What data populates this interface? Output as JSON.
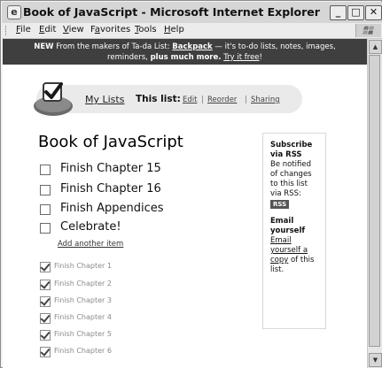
{
  "window": {
    "title": "Book of JavaScript - Microsoft Internet Explorer",
    "app_icon": "e",
    "controls": {
      "minimize": "_",
      "maximize": "□",
      "close": "✕"
    }
  },
  "menu": [
    {
      "label": "File",
      "key": "F"
    },
    {
      "label": "Edit",
      "key": "E"
    },
    {
      "label": "View",
      "key": "V"
    },
    {
      "label": "Favorites",
      "key": "a"
    },
    {
      "label": "Tools",
      "key": "T"
    },
    {
      "label": "Help",
      "key": "H"
    }
  ],
  "banner": {
    "new": "NEW",
    "text1": "From the makers of Ta-da List:",
    "backpack": "Backpack",
    "text2": "— it's to-do lists, notes, images,",
    "text3": "reminders,",
    "plus": "plus much more.",
    "try": "Try it free",
    "bang": "!"
  },
  "nav": {
    "my_lists": "My Lists",
    "this_list": "This list:",
    "edit": "Edit",
    "reorder": "Reorder",
    "sharing": "Sharing",
    "sep": "|"
  },
  "list": {
    "title": "Book of JavaScript",
    "items": [
      {
        "label": "Finish Chapter 15",
        "checked": false
      },
      {
        "label": "Finish Chapter 16",
        "checked": false
      },
      {
        "label": "Finish Appendices",
        "checked": false
      },
      {
        "label": "Celebrate!",
        "checked": false
      }
    ],
    "add_link": "Add another item",
    "completed": [
      {
        "label": "Finish Chapter 1",
        "checked": true
      },
      {
        "label": "Finish Chapter 2",
        "checked": true
      },
      {
        "label": "Finish Chapter 3",
        "checked": true
      },
      {
        "label": "Finish Chapter 4",
        "checked": true
      },
      {
        "label": "Finish Chapter 5",
        "checked": true
      },
      {
        "label": "Finish Chapter 6",
        "checked": true
      }
    ]
  },
  "sidebar": {
    "rss_heading": "Subscribe via RSS",
    "rss_text": "Be notified of changes to this list via RSS:",
    "rss_badge": "RSS",
    "email_heading": "Email yourself",
    "email_link": "Email yourself a copy",
    "email_text": "of this list."
  },
  "colors": {
    "banner_bg": "#3f3f3f",
    "pill_bg": "#eaeaea"
  }
}
